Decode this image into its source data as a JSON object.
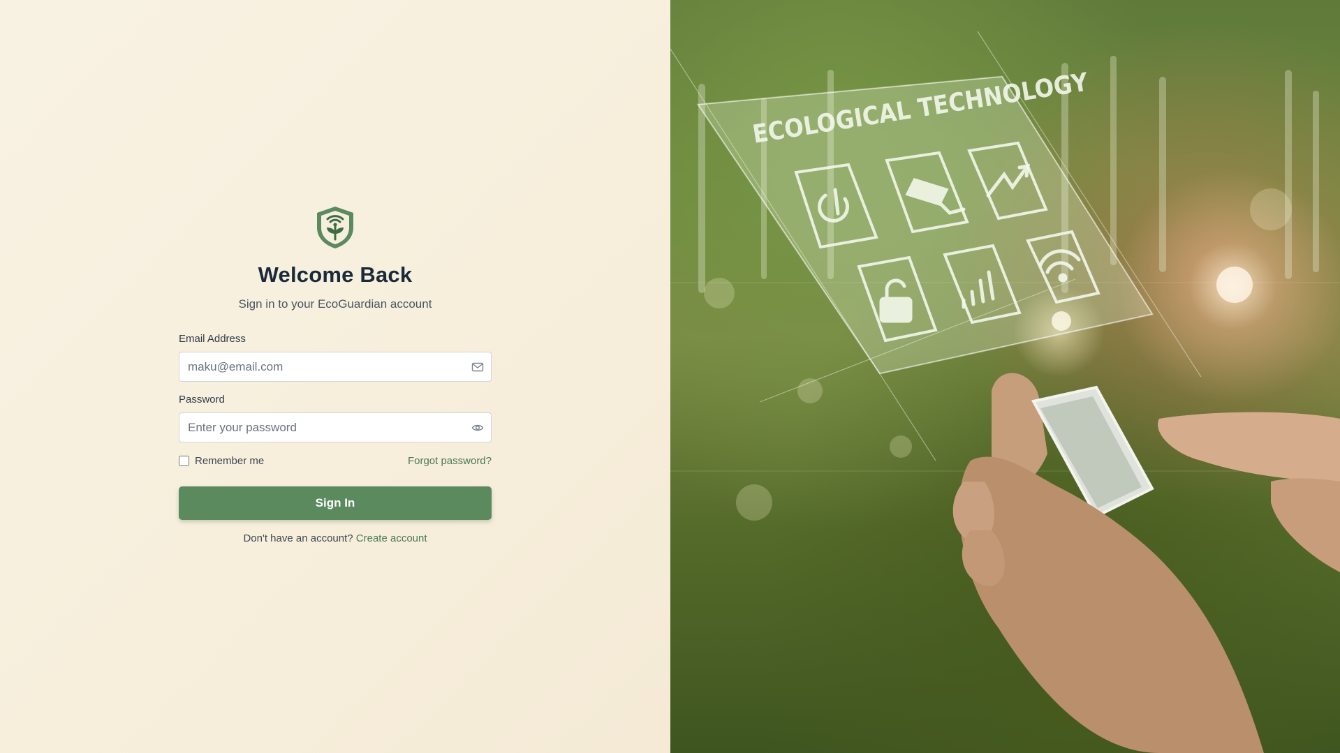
{
  "brand": {
    "logo_icon": "shield-sprout-wifi-icon",
    "accent": "#5a8a5e"
  },
  "login": {
    "title": "Welcome Back",
    "subtitle": "Sign in to your EcoGuardian account",
    "email": {
      "label": "Email Address",
      "value": "",
      "placeholder": "maku@email.com",
      "icon": "mail-icon"
    },
    "password": {
      "label": "Password",
      "value": "",
      "placeholder": "Enter your password",
      "icon": "eye-icon"
    },
    "remember_label": "Remember me",
    "remember_checked": false,
    "forgot_label": "Forgot password?",
    "submit_label": "Sign In",
    "signup_prompt": "Don't have an account?",
    "signup_link": "Create account"
  },
  "hero": {
    "panel_text": "ECOLOGICAL TECHNOLOGY",
    "icons": [
      "power-icon",
      "camera-icon",
      "chart-up-icon",
      "unlock-icon",
      "signal-bars-icon",
      "wifi-icon"
    ]
  }
}
